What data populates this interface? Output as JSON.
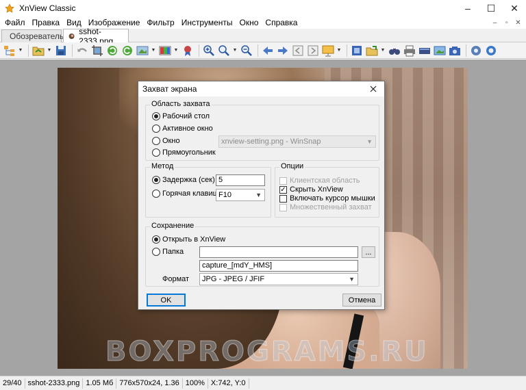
{
  "window": {
    "title": "XnView Classic",
    "controls": [
      "–",
      "☐",
      "✕"
    ]
  },
  "menu": {
    "items": [
      "Файл",
      "Правка",
      "Вид",
      "Изображение",
      "Фильтр",
      "Инструменты",
      "Окно",
      "Справка"
    ],
    "mdi_controls": [
      "–",
      "▫",
      "✕"
    ]
  },
  "tabs": [
    {
      "label": "Обозреватель",
      "active": false
    },
    {
      "label": "sshot-2333.png",
      "active": true
    }
  ],
  "toolbar": {
    "icons": [
      "browser-tree-icon",
      "open-folder-icon",
      "save-icon",
      "undo-icon",
      "crop-icon",
      "rotate-left-icon",
      "rotate-right-icon",
      "adjust-icon",
      "colors-icon",
      "effects-icon",
      "zoom-in-icon",
      "zoom-select-icon",
      "zoom-out-icon",
      "prev-arrow-icon",
      "next-arrow-icon",
      "first-page-icon",
      "last-page-icon",
      "slideshow-icon",
      "fullscreen-icon",
      "export-icon",
      "find-icon",
      "print-icon",
      "scanner-icon",
      "capture-icon",
      "camera-icon",
      "settings-icon",
      "help-icon"
    ]
  },
  "status": {
    "index": "29/40",
    "filename": "sshot-2333.png",
    "size": "1.05 Мб",
    "dimensions": "776x570x24, 1.36",
    "zoom": "100%",
    "coords": "X:742, Y:0"
  },
  "watermark": "BOXPROGRAMS.RU",
  "dialog": {
    "title": "Захват экрана",
    "capture_area": {
      "label": "Область захвата",
      "options": [
        {
          "label": "Рабочий стол",
          "selected": true
        },
        {
          "label": "Активное окно",
          "selected": false
        },
        {
          "label": "Окно",
          "selected": false
        },
        {
          "label": "Прямоугольник",
          "selected": false
        }
      ],
      "window_select_value": "xnview-setting.png - WinSnap"
    },
    "method": {
      "label": "Метод",
      "delay_label": "Задержка (сек)",
      "delay_selected": true,
      "delay_value": "5",
      "hotkey_label": "Горячая клавиша",
      "hotkey_selected": false,
      "hotkey_value": "F10"
    },
    "options": {
      "label": "Опции",
      "items": [
        {
          "label": "Клиентская область",
          "checked": false,
          "enabled": false
        },
        {
          "label": "Скрыть XnView",
          "checked": true,
          "enabled": true
        },
        {
          "label": "Включать курсор мышки",
          "checked": false,
          "enabled": true
        },
        {
          "label": "Множественный захват",
          "checked": false,
          "enabled": false
        }
      ]
    },
    "save": {
      "label": "Сохранение",
      "open_label": "Открыть в XnView",
      "open_selected": true,
      "folder_label": "Папка",
      "folder_selected": false,
      "folder_value": "",
      "browse_label": "...",
      "filename_value": "capture_[mdY_HMS]",
      "format_label": "Формат",
      "format_value": "JPG - JPEG / JFIF"
    },
    "ok_label": "OK",
    "cancel_label": "Отмена"
  }
}
